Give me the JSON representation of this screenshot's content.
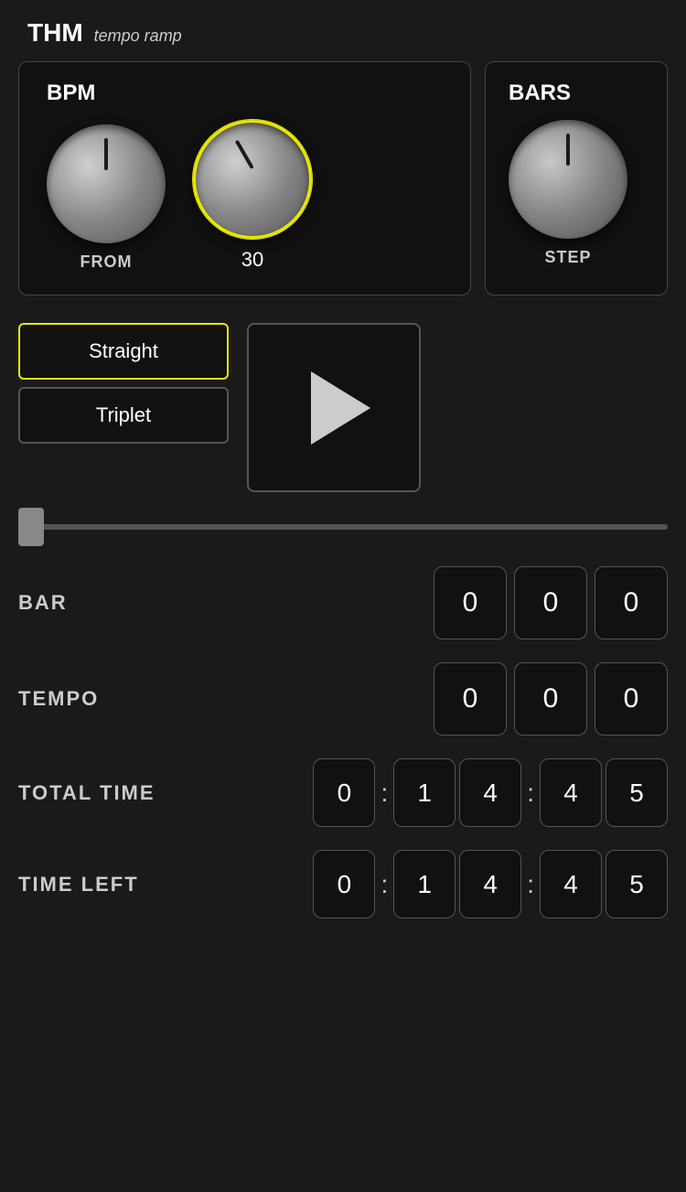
{
  "header": {
    "app_name": "THM",
    "subtitle": "tempo ramp"
  },
  "bpm_panel": {
    "title": "BPM",
    "from_label": "FROM",
    "to_value": "30"
  },
  "bars_panel": {
    "title": "BARS",
    "step_label": "STEP"
  },
  "buttons": {
    "straight_label": "Straight",
    "triplet_label": "Triplet",
    "play_label": "Play"
  },
  "bar_section": {
    "label": "BAR",
    "digits": [
      "0",
      "0",
      "0"
    ]
  },
  "tempo_section": {
    "label": "TEMPO",
    "digits": [
      "0",
      "0",
      "0"
    ]
  },
  "total_time_section": {
    "label": "TOTAL TIME",
    "d1": "0",
    "d2": "1",
    "d3": "4",
    "d4": "4",
    "d5": "5"
  },
  "time_left_section": {
    "label": "TIME LEFT",
    "d1": "0",
    "d2": "1",
    "d3": "4",
    "d4": "4",
    "d5": "5"
  }
}
